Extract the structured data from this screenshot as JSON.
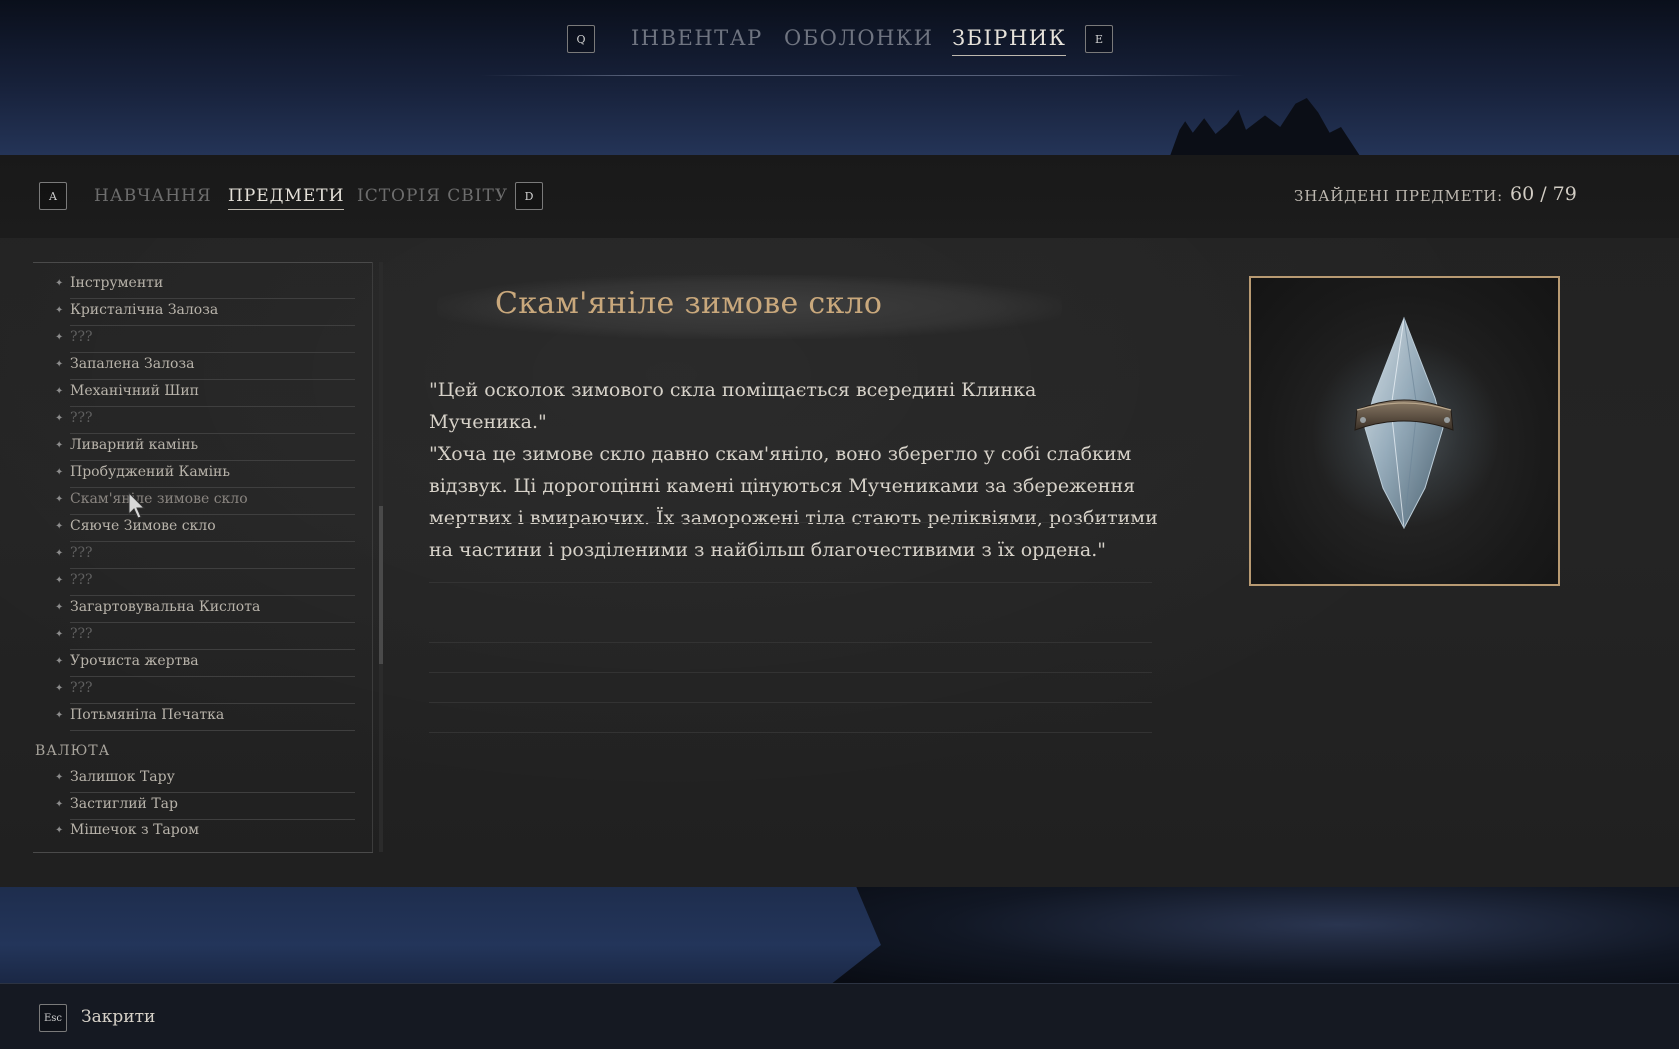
{
  "top_nav": {
    "key_left": "Q",
    "key_right": "E",
    "tabs": [
      {
        "label": "ІНВЕНТАР",
        "active": false
      },
      {
        "label": "ОБОЛОНКИ",
        "active": false
      },
      {
        "label": "ЗБІРНИК",
        "active": true
      }
    ]
  },
  "sub_nav": {
    "key_left": "A",
    "key_right": "D",
    "tabs": [
      {
        "label": "НАВЧАННЯ",
        "active": false
      },
      {
        "label": "ПРЕДМЕТИ",
        "active": true
      },
      {
        "label": "ІСТОРІЯ СВІТУ",
        "active": false
      }
    ],
    "found_label": "ЗНАЙДЕНІ ПРЕДМЕТИ:",
    "found_count": "60 / 79"
  },
  "list": {
    "items": [
      {
        "label": "Інструменти"
      },
      {
        "label": "Кристалічна Залоза"
      },
      {
        "label": "???"
      },
      {
        "label": "Запалена Залоза"
      },
      {
        "label": "Механічний Шип"
      },
      {
        "label": "???"
      },
      {
        "label": "Ливарний камінь"
      },
      {
        "label": "Пробуджений Камінь"
      },
      {
        "label": "Скам'яніле зимове скло"
      },
      {
        "label": "Сяюче Зимове скло"
      },
      {
        "label": "???"
      },
      {
        "label": "???"
      },
      {
        "label": "Загартовувальна Кислота"
      },
      {
        "label": "???"
      },
      {
        "label": "Урочиста жертва"
      },
      {
        "label": "???"
      },
      {
        "label": "Потьмяніла Печатка"
      }
    ],
    "currency_category": "ВАЛЮТА",
    "currency_items": [
      {
        "label": "Залишок Тару"
      },
      {
        "label": "Застиглий Тар"
      },
      {
        "label": "Мішечок з Таром"
      }
    ]
  },
  "detail": {
    "title": "Скам'яніле зимове скло",
    "lines": [
      "\"Цей осколок зимового скла поміщається всередині Клинка Мученика.\"",
      "\"Хоча це зимове скло давно скам'яніло, воно зберегло у собі слабким відзвук. Ці дорогоцінні камені цінуються Мучениками за збереження мертвих і вмираючих. Їх заморожені тіла стають реліквіями, розбитими на частини і розділеними з найбільш благочестивими з їх ордена.\""
    ],
    "image_icon": "frozen-crystal-icon"
  },
  "footer": {
    "key": "Esc",
    "close_label": "Закрити"
  },
  "colors": {
    "title_accent": "#c9a87c",
    "frame_border": "#b89a72",
    "active_tab": "#e6e2da",
    "inactive_tab": "#6f7480"
  }
}
